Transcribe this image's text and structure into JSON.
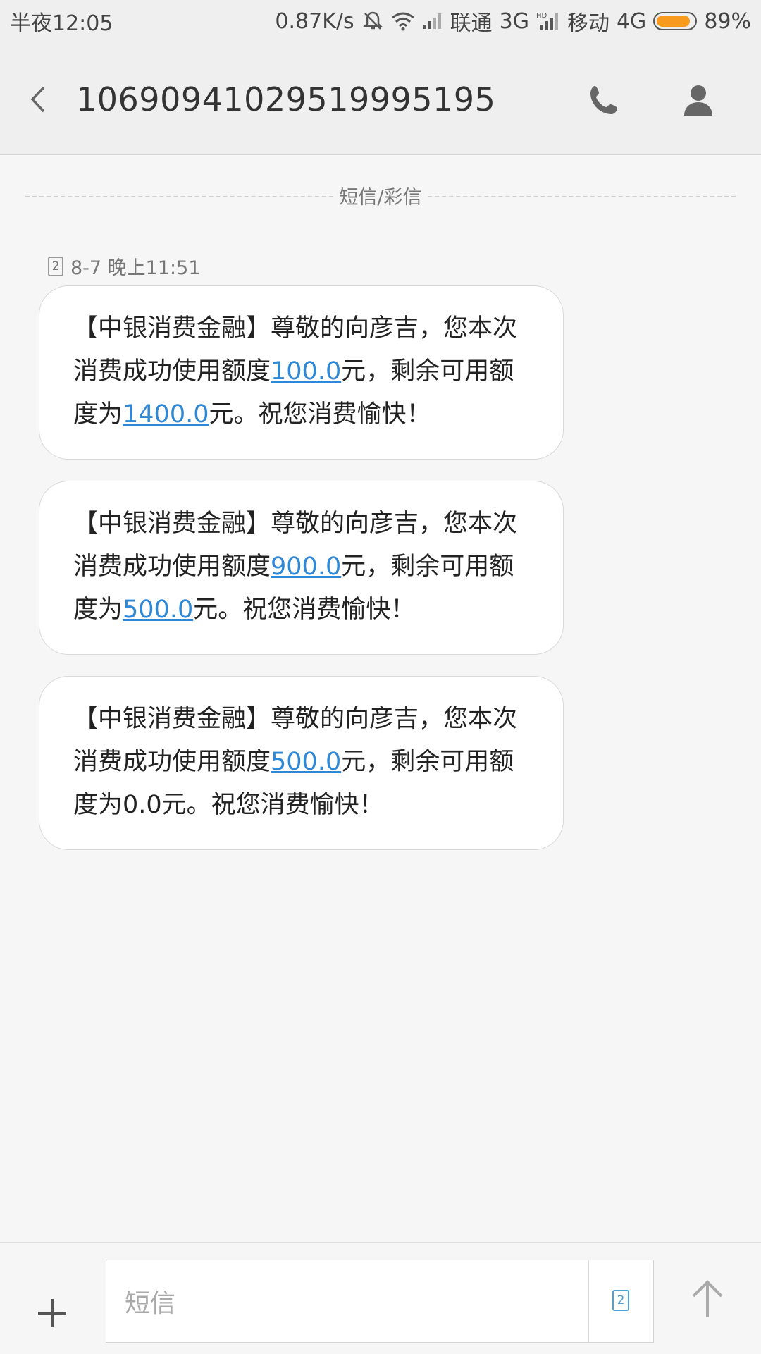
{
  "status_bar": {
    "time": "半夜12:05",
    "net_speed": "0.87K/s",
    "carrier1": "联通",
    "carrier1_net": "3G",
    "carrier2": "移动",
    "carrier2_net": "4G",
    "battery_text": "89%",
    "battery_level": 0.89,
    "battery_color": "#f79a1e",
    "icons": [
      "mute-bell-icon",
      "wifi-icon",
      "signal-icon",
      "hd-signal-icon",
      "battery-icon"
    ]
  },
  "header": {
    "title": "1069094102951999519 5",
    "title_display": "10690941029519995195",
    "icons": [
      "back-icon",
      "phone-icon",
      "contact-icon"
    ]
  },
  "conversation": {
    "divider_label": "短信/彩信",
    "sim_badge": "2",
    "timestamp": "8-7 晚上11:51",
    "link_color": "#2e88d6",
    "messages": [
      {
        "prefix": "【中银消费金融】尊敬的向彦吉，您本次消费成功使用额度",
        "used": "100.0",
        "mid": "元，剩余可用额度为",
        "remaining": "1400.0",
        "suffix": "元。祝您消费愉快！"
      },
      {
        "prefix": "【中银消费金融】尊敬的向彦吉，您本次消费成功使用额度",
        "used": "900.0",
        "mid": "元，剩余可用额度为",
        "remaining": "500.0",
        "suffix": "元。祝您消费愉快！"
      },
      {
        "prefix": "【中银消费金融】尊敬的向彦吉，您本次消费成功使用额度",
        "used": "500.0",
        "mid": "元，剩余可用额度为0.0元。祝您消费愉快！"
      }
    ]
  },
  "composer": {
    "placeholder": "短信",
    "sim_select": "2",
    "icons": [
      "add-icon",
      "sim-select-icon",
      "send-icon"
    ]
  }
}
